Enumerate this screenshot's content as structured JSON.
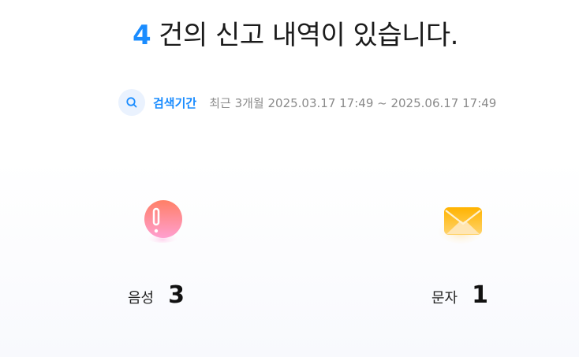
{
  "summary": {
    "count": "4",
    "text": "건의 신고 내역이 있습니다."
  },
  "search": {
    "icon": "search-icon",
    "label": "검색기간",
    "period": "최근 3개월 2025.03.17 17:49 ~ 2025.06.17 17:49"
  },
  "stats": {
    "voice": {
      "icon": "voice-alert-icon",
      "label": "음성",
      "count": "3"
    },
    "text": {
      "icon": "message-envelope-icon",
      "label": "문자",
      "count": "1"
    }
  },
  "colors": {
    "accent": "#1a8cff",
    "search_icon_bg": "#eaf2fe",
    "muted_text": "#8a8a8a",
    "voice_icon_start": "#ff7f66",
    "voice_icon_end": "#ff9fd0",
    "text_icon_start": "#ffb300",
    "text_icon_end": "#ffd36b"
  }
}
